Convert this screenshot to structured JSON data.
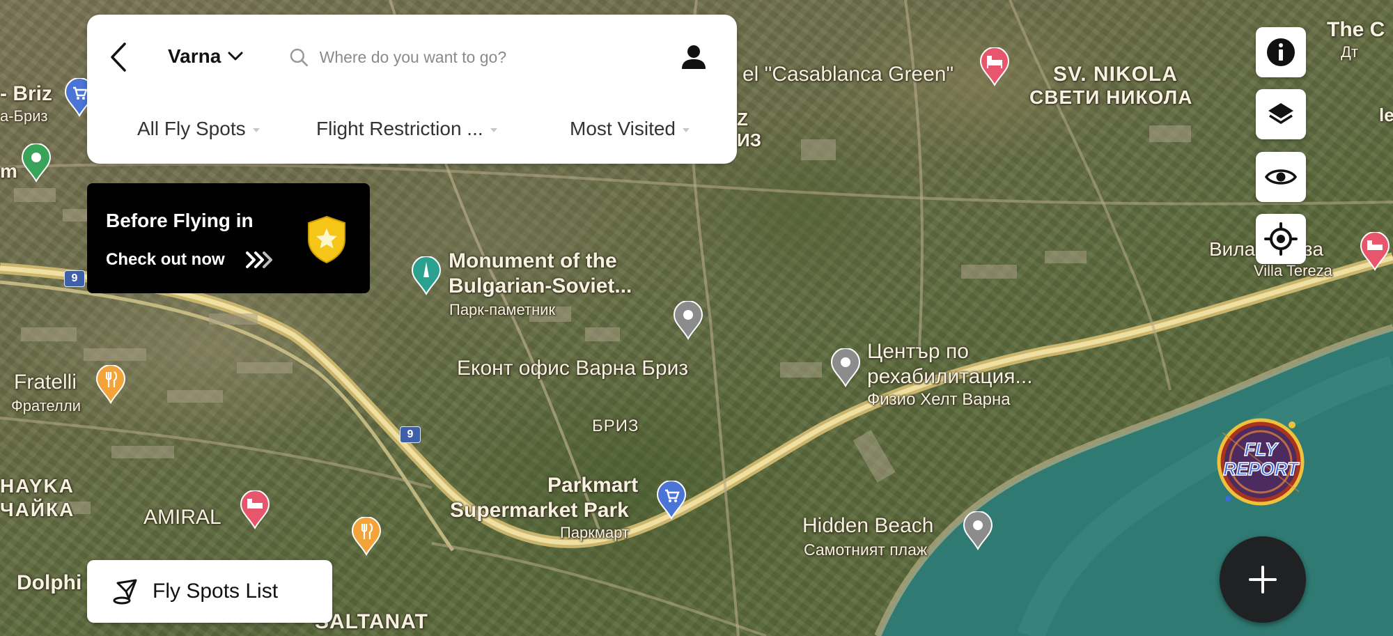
{
  "search": {
    "city": "Varna",
    "placeholder": "Where do you want to go?"
  },
  "filters": [
    "All Fly Spots",
    "Flight Restriction ...",
    "Most Visited"
  ],
  "promo": {
    "title": "Before Flying in",
    "cta": "Check out now"
  },
  "toolbar": {
    "info_icon": "info-icon",
    "layers_icon": "layers-icon",
    "visibility_icon": "eye-icon",
    "locate_icon": "crosshair-icon"
  },
  "badge": {
    "line1": "FLY",
    "line2": "REPORT"
  },
  "fly_spots_list_label": "Fly Spots List",
  "map_labels": {
    "briz_left": "- Briz",
    "briz_left_cyr": "а-Бриз",
    "m": "m",
    "casablanca": "el \"Casablanca Green\"",
    "z": "Z",
    "z3": "ИЗ",
    "sv_nikola": "SV. NIKOLA",
    "sv_nikola_cyr": "СВЕТИ НИКОЛА",
    "the_c": "The C",
    "the_c_cyr": "Дт",
    "le": "le",
    "monument_1": "Monument of the",
    "monument_2": "Bulgarian-Soviet...",
    "monument_cyr": "Парк-паметник",
    "villa_cyr": "Вила Тереза",
    "villa": "Villa Tereza",
    "ekont": "Еконт офис Варна Бриз",
    "center_1": "Център по",
    "center_2": "рехабилитация...",
    "center_cyr": "Физио Хелт Варна",
    "fratelli": "Fratelli",
    "fratelli_cyr": "Фрателли",
    "briz_cyr": "БРИЗ",
    "chayka": "HAYKA",
    "chayka_cyr": "ЧАЙКА",
    "amiral": "AMIRAL",
    "parkmart_1": "Parkmart",
    "parkmart_2": "Supermarket Park",
    "parkmart_cyr": "Паркмарт",
    "hidden_beach": "Hidden Beach",
    "hidden_beach_cyr": "Самотният плаж",
    "dolphi": "Dolphi",
    "saltanat": "SALTANAT",
    "road_9a": "9",
    "road_9b": "9"
  },
  "colors": {
    "hotel_pin": "#e8566e",
    "restaurant_pin": "#f2a33a",
    "shopping_pin": "#4a74d6",
    "park_pin": "#3aa35a",
    "monument_pin": "#2aa08f",
    "place_pin": "#8c8c8c",
    "road": "#e6d08a",
    "sea": "#2f7a73",
    "shield": "#f5c518"
  }
}
